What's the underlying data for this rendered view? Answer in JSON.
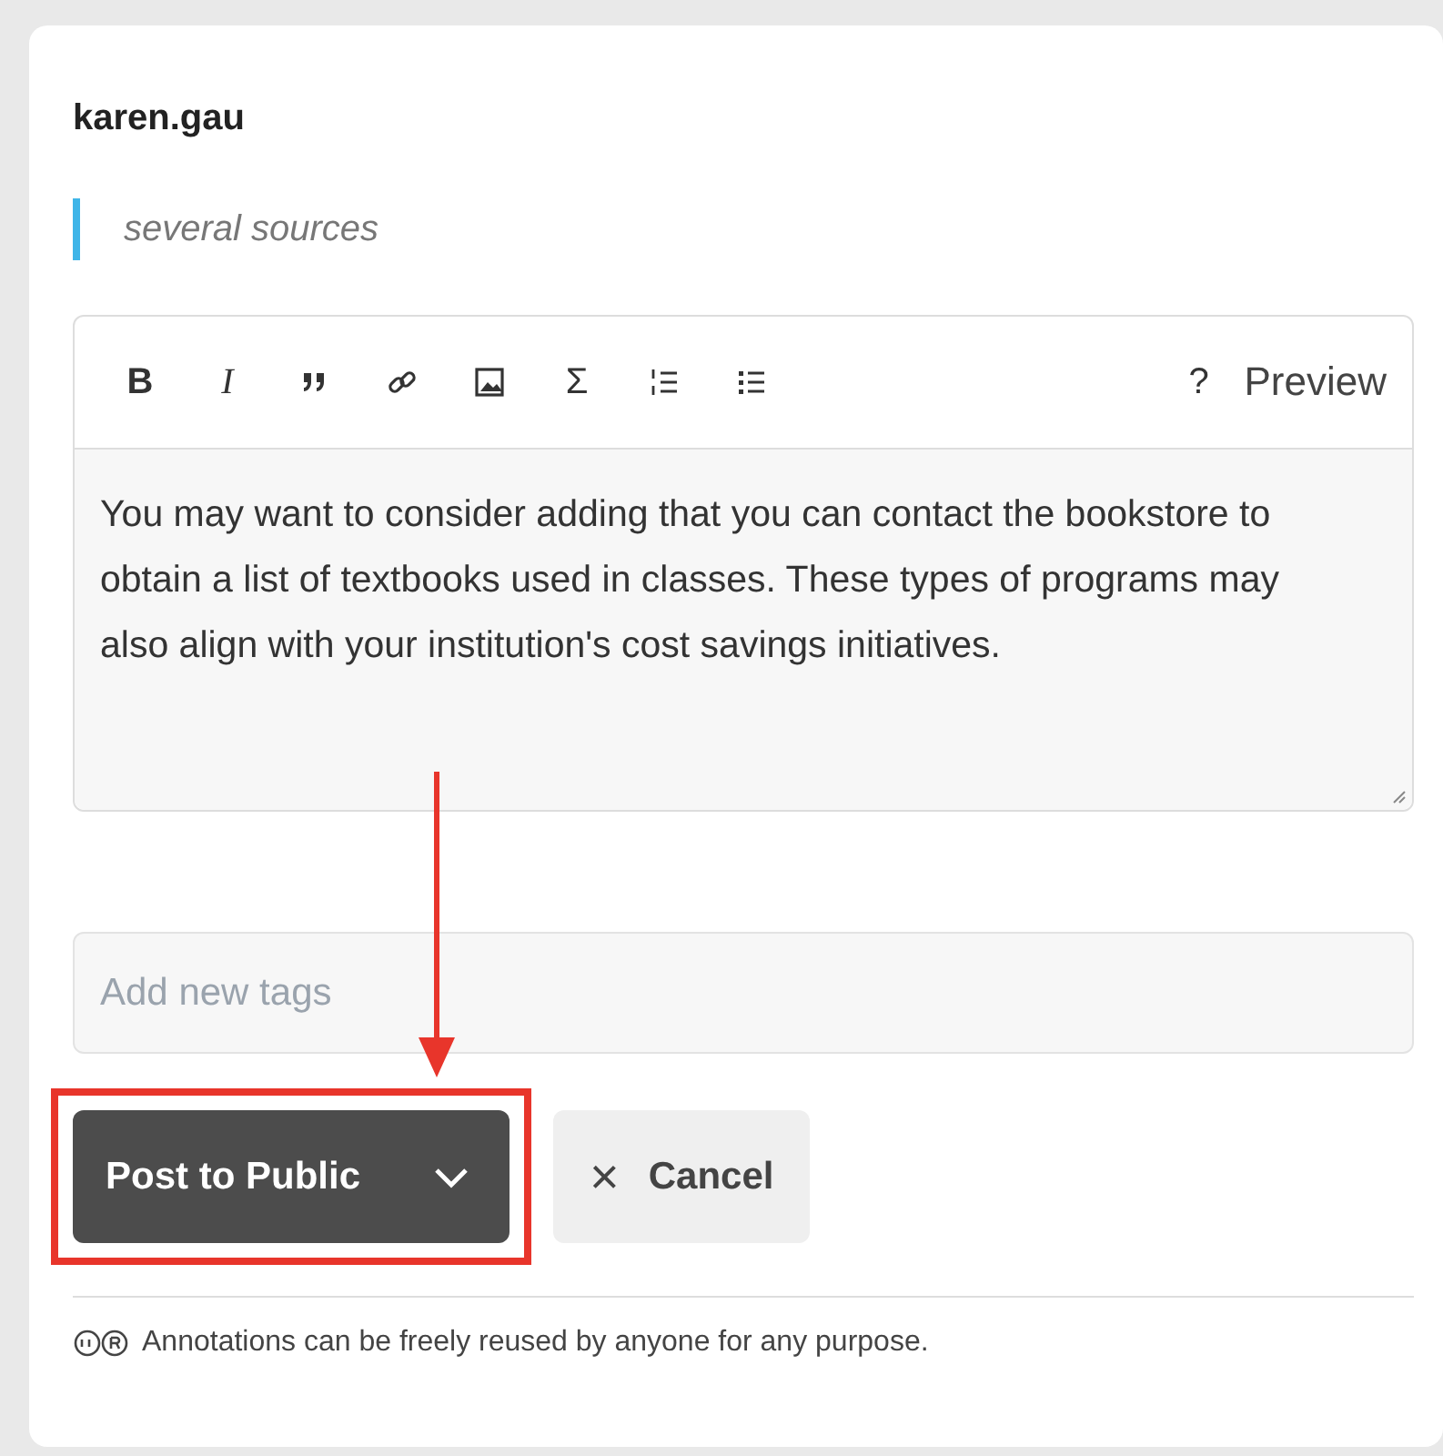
{
  "user": "karen.gau",
  "quote": "several sources",
  "toolbar": {
    "tools": [
      {
        "kind": "bold",
        "glyph": "B"
      },
      {
        "kind": "italic",
        "glyph": "I"
      },
      {
        "kind": "quote"
      },
      {
        "kind": "link"
      },
      {
        "kind": "image"
      },
      {
        "kind": "math",
        "glyph": "Σ"
      },
      {
        "kind": "numbered-list"
      },
      {
        "kind": "bulleted-list"
      }
    ],
    "help": "?",
    "preview": "Preview"
  },
  "body": "You may want to consider adding that you can contact the bookstore to obtain a list of textbooks used in classes. These types of programs may also align with your institution's cost savings initiatives.",
  "tags": {
    "placeholder": "Add new tags"
  },
  "post_button": "Post to Public",
  "cancel_button": {
    "icon": "×",
    "label": "Cancel"
  },
  "license": "Annotations can be freely reused by anyone for any purpose."
}
